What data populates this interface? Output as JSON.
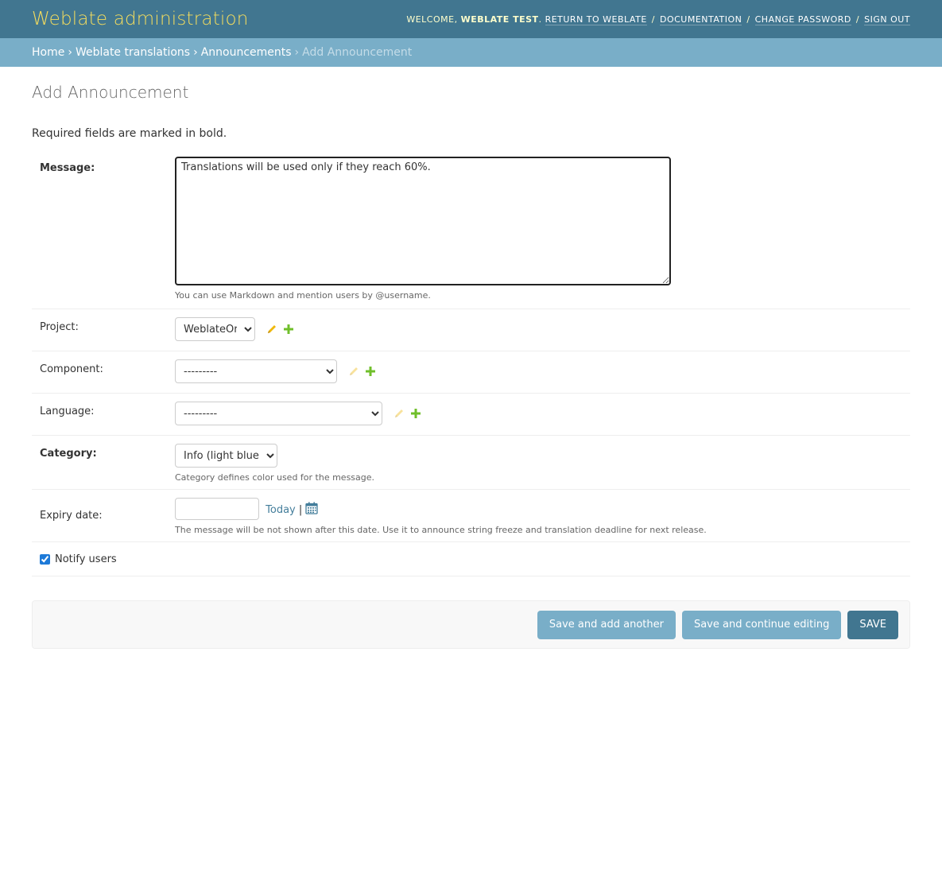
{
  "header": {
    "title": "Weblate administration",
    "welcome": "Welcome,",
    "user": "Weblate Test",
    "links": [
      "Return to Weblate",
      "Documentation",
      "Change password",
      "Sign out"
    ]
  },
  "breadcrumbs": {
    "items": [
      "Home",
      "Weblate translations",
      "Announcements"
    ],
    "current": "Add Announcement"
  },
  "page": {
    "title": "Add Announcement",
    "required_note": "Required fields are marked in bold."
  },
  "form": {
    "message": {
      "label": "Message:",
      "value": "Translations will be used only if they reach 60%.",
      "help": "You can use Markdown and mention users by @username."
    },
    "project": {
      "label": "Project:",
      "selected": "WeblateOrg"
    },
    "component": {
      "label": "Component:",
      "selected": "---------"
    },
    "language": {
      "label": "Language:",
      "selected": "---------"
    },
    "category": {
      "label": "Category:",
      "selected": "Info (light blue)",
      "help": "Category defines color used for the message."
    },
    "expiry": {
      "label": "Expiry date:",
      "value": "",
      "today": "Today",
      "separator": "|",
      "help": "The message will be not shown after this date. Use it to announce string freeze and translation deadline for next release."
    },
    "notify": {
      "label": "Notify users",
      "checked": true
    }
  },
  "buttons": {
    "save_add": "Save and add another",
    "save_continue": "Save and continue editing",
    "save": "Save"
  },
  "colors": {
    "header_bg": "#417690",
    "breadcrumb_bg": "#79aec8",
    "brand": "#f5dd5d",
    "pencil": "#efb80b",
    "plus": "#70bf2b"
  }
}
